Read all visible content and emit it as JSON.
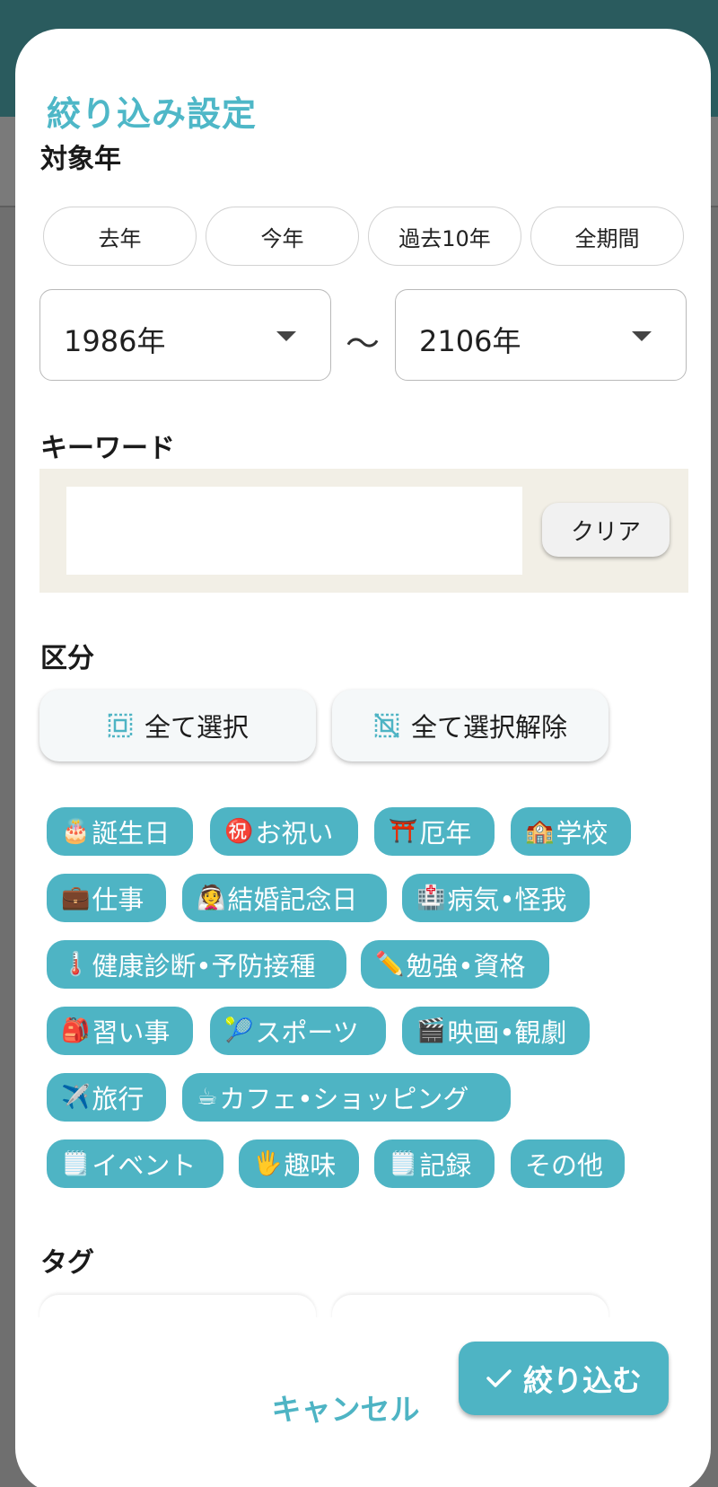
{
  "dialog": {
    "title": "絞り込み設定"
  },
  "year_section": {
    "label": "対象年",
    "presets": [
      "去年",
      "今年",
      "過去10年",
      "全期間"
    ],
    "from": "1986年",
    "to": "2106年",
    "separator": "〜"
  },
  "keyword_section": {
    "label": "キーワード",
    "value": "",
    "clear_label": "クリア"
  },
  "category_section": {
    "label": "区分",
    "select_all": "全て選択",
    "deselect_all": "全て選択解除",
    "chips": [
      {
        "emoji": "🎂",
        "label": "誕生日"
      },
      {
        "emoji": "㊗️",
        "label": "お祝い"
      },
      {
        "emoji": "⛩️",
        "label": "厄年"
      },
      {
        "emoji": "🏫",
        "label": "学校"
      },
      {
        "emoji": "💼",
        "label": "仕事"
      },
      {
        "emoji": "👰",
        "label": "結婚記念日"
      },
      {
        "emoji": "🏥",
        "label": "病気•怪我"
      },
      {
        "emoji": "🌡️",
        "label": "健康診断•予防接種"
      },
      {
        "emoji": "✏️",
        "label": "勉強•資格"
      },
      {
        "emoji": "🎒",
        "label": "習い事"
      },
      {
        "emoji": "🎾",
        "label": "スポーツ"
      },
      {
        "emoji": "🎬",
        "label": "映画•観劇"
      },
      {
        "emoji": "✈️",
        "label": "旅行"
      },
      {
        "emoji": "☕",
        "label": "カフェ•ショッピング"
      },
      {
        "emoji": "🗒️",
        "label": "イベント"
      },
      {
        "emoji": "🖐️",
        "label": "趣味"
      },
      {
        "emoji": "🗒️",
        "label": "記録"
      },
      {
        "emoji": "",
        "label": "その他"
      }
    ]
  },
  "tag_section": {
    "label": "タグ"
  },
  "actions": {
    "cancel": "キャンセル",
    "apply": "絞り込む"
  },
  "colors": {
    "accent": "#4eb4c4",
    "title": "#4eb7c7",
    "keyword_bg": "#f2efe6"
  }
}
